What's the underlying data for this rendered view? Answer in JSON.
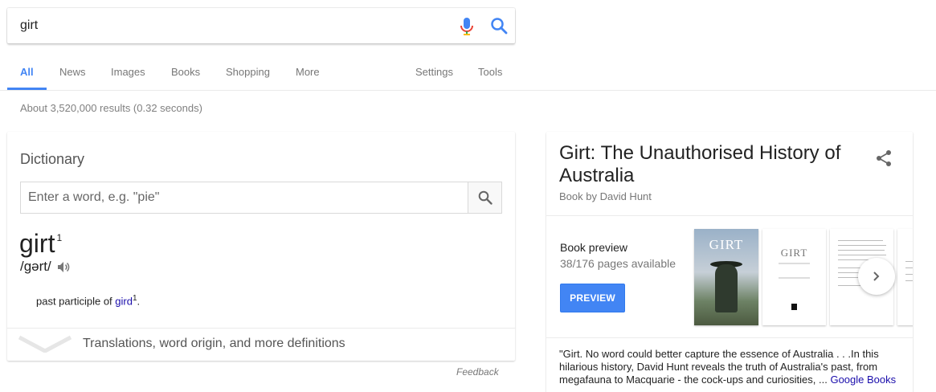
{
  "search": {
    "query": "girt"
  },
  "tabs": [
    {
      "label": "All"
    },
    {
      "label": "News"
    },
    {
      "label": "Images"
    },
    {
      "label": "Books"
    },
    {
      "label": "Shopping"
    },
    {
      "label": "More"
    },
    {
      "label": "Settings"
    },
    {
      "label": "Tools"
    }
  ],
  "stats": "About 3,520,000 results (0.32 seconds)",
  "dictionary": {
    "title": "Dictionary",
    "placeholder": "Enter a word, e.g. \"pie\"",
    "word": "girt",
    "word_sup": "1",
    "pronunciation": "/ɡərt/",
    "definition_prefix": "past participle of ",
    "definition_link": "gird",
    "definition_link_sup": "1",
    "definition_suffix": ".",
    "more_label": "Translations, word origin, and more definitions"
  },
  "feedback": "Feedback",
  "knowledge_panel": {
    "title": "Girt: The Unauthorised History of Australia",
    "subtitle": "Book by David Hunt",
    "preview_label": "Book preview",
    "pages_available": "38/176 pages available",
    "preview_button": "PREVIEW",
    "cover_title": "GIRT",
    "title_page_text": "GIRT",
    "description": "\"Girt. No word could better capture the essence of Australia . . .In this hilarious history, David Hunt reveals the truth of Australia's past, from megafauna to Macquarie - the cock-ups and curiosities, ... ",
    "description_link": "Google Books"
  },
  "colors": {
    "accent": "#4285f4",
    "link": "#1a0dab"
  },
  "icons": [
    "mic-icon",
    "search-icon",
    "speaker-icon",
    "chevron-down-icon",
    "share-icon",
    "chevron-right-icon"
  ]
}
